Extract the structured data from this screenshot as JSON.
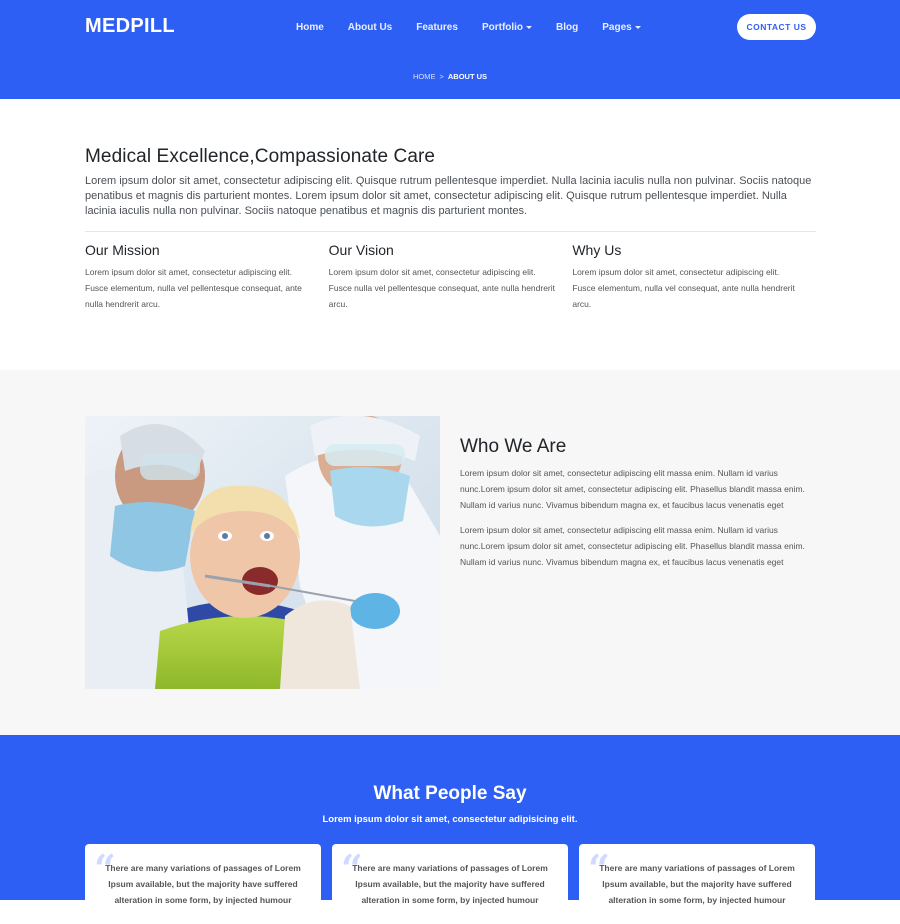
{
  "header": {
    "logo": "MEDPILL",
    "nav": [
      {
        "label": "Home",
        "dropdown": false
      },
      {
        "label": "About Us",
        "dropdown": false
      },
      {
        "label": "Features",
        "dropdown": false
      },
      {
        "label": "Portfolio",
        "dropdown": true
      },
      {
        "label": "Blog",
        "dropdown": false
      },
      {
        "label": "Pages",
        "dropdown": true
      }
    ],
    "contact_label": "CONTACT US",
    "breadcrumb": {
      "home": "HOME",
      "separator": ">",
      "current": "ABOUT US"
    },
    "brand_color": "#2d5ff5"
  },
  "intro": {
    "title": "Medical Excellence,Compassionate Care",
    "text": "Lorem ipsum dolor sit amet, consectetur adipiscing elit. Quisque rutrum pellentesque imperdiet. Nulla lacinia iaculis nulla non pulvinar. Sociis natoque penatibus et magnis dis parturient montes. Lorem ipsum dolor sit amet, consectetur adipiscing elit. Quisque rutrum pellentesque imperdiet. Nulla lacinia iaculis nulla non pulvinar. Sociis natoque penatibus et magnis dis parturient montes."
  },
  "columns": [
    {
      "title": "Our Mission",
      "text": "Lorem ipsum dolor sit amet, consectetur adipiscing elit. Fusce elementum, nulla vel pellentesque consequat, ante nulla hendrerit arcu."
    },
    {
      "title": "Our Vision",
      "text": "Lorem ipsum dolor sit amet, consectetur adipiscing elit. Fusce nulla vel pellentesque consequat, ante nulla hendrerit arcu."
    },
    {
      "title": "Why Us",
      "text": "Lorem ipsum dolor sit amet, consectetur adipiscing elit. Fusce elementum, nulla vel consequat, ante nulla hendrerit arcu."
    }
  ],
  "who": {
    "title": "Who We Are",
    "paragraphs": [
      "Lorem ipsum dolor sit amet, consectetur adipiscing elit massa enim. Nullam id varius nunc.Lorem ipsum dolor sit amet, consectetur adipiscing elit. Phasellus blandit massa enim. Nullam id varius nunc. Vivamus bibendum magna ex, et faucibus lacus venenatis eget",
      "Lorem ipsum dolor sit amet, consectetur adipiscing elit massa enim. Nullam id varius nunc.Lorem ipsum dolor sit amet, consectetur adipiscing elit. Phasellus blandit massa enim. Nullam id varius nunc. Vivamus bibendum magna ex, et faucibus lacus venenatis eget"
    ]
  },
  "testimonials": {
    "title": "What People Say",
    "subtitle": "Lorem ipsum dolor sit amet, consectetur adipisicing elit.",
    "quote_mark": "“",
    "cards": [
      {
        "text": "There are many variations of passages of Lorem Ipsum available, but the majority have suffered alteration in some form, by injected humour"
      },
      {
        "text": "There are many variations of passages of Lorem Ipsum available, but the majority have suffered alteration in some form, by injected humour"
      },
      {
        "text": "There are many variations of passages of Lorem Ipsum available, but the majority have suffered alteration in some form, by injected humour"
      }
    ]
  }
}
